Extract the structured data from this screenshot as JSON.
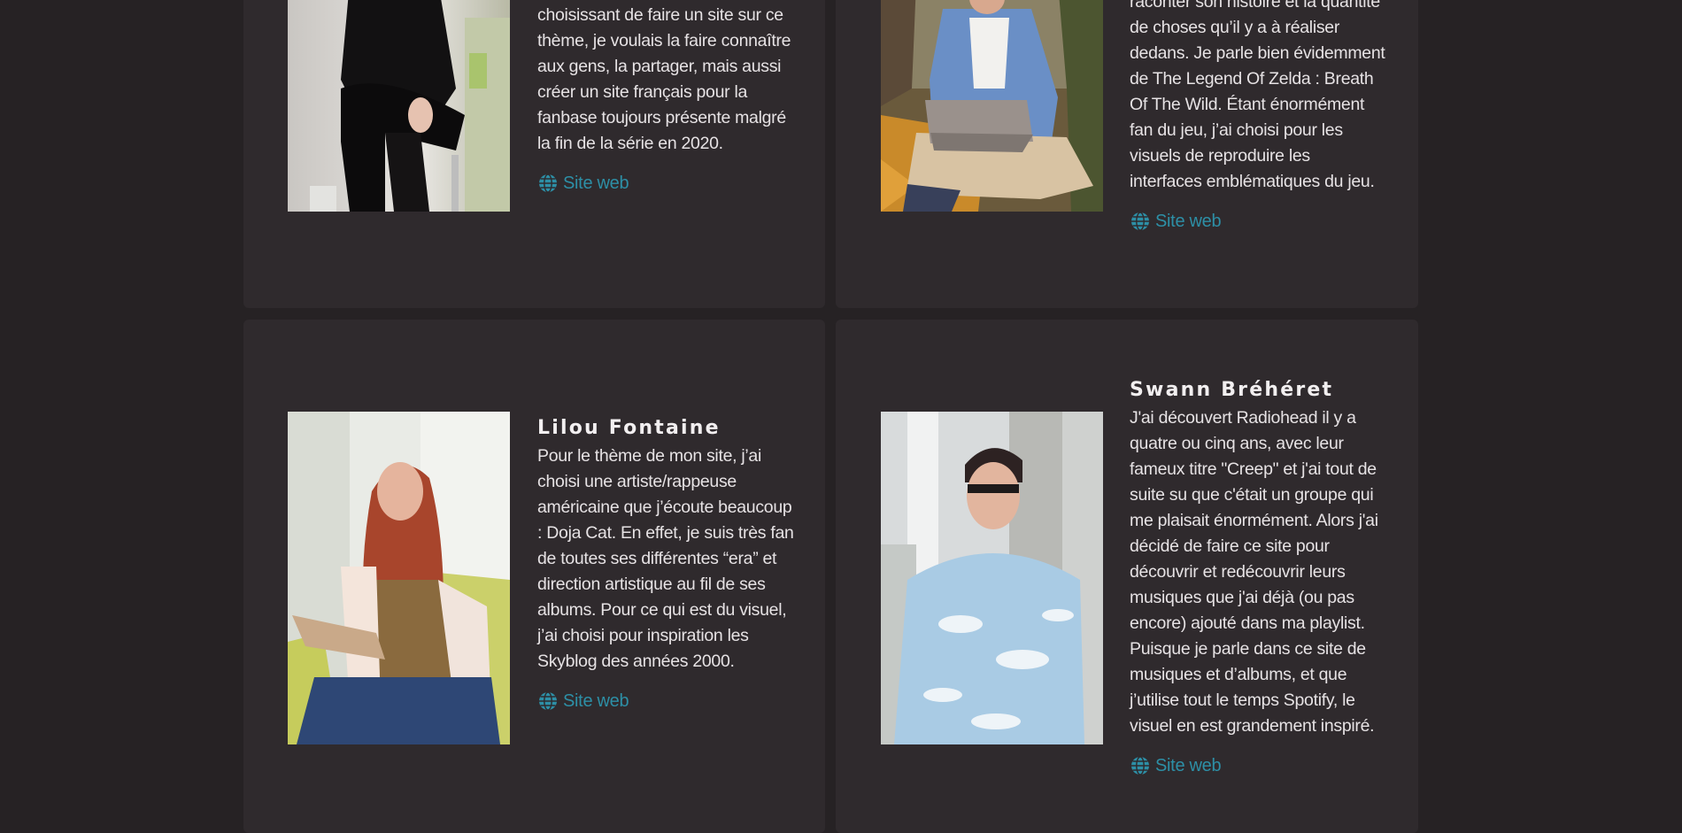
{
  "cards": [
    {
      "bio": "choisissant de faire un site sur ce thème, je voulais la faire connaître aux gens, la partager, mais aussi créer un site français pour la fanbase toujours présente malgré la fin de la série en 2020.",
      "link_label": "Site web",
      "link_icon": "globe-icon"
    },
    {
      "bio": "raconter son histoire et la quantité de choses qu’il y a à réaliser dedans. Je parle bien évidemment de The Legend Of Zelda : Breath Of The Wild. Étant énormément fan du jeu, j’ai choisi pour les visuels de reproduire les interfaces emblématiques du jeu.",
      "link_label": "Site web",
      "link_icon": "globe-icon"
    },
    {
      "name": "Lilou Fontaine",
      "bio": "Pour le thème de mon site, j’ai choisi une artiste/rappeuse américaine que j’écoute beaucoup : Doja Cat. En effet, je suis très fan de toutes ses différentes “era” et direction artistique au fil de ses albums. Pour ce qui est du visuel, j’ai choisi pour inspiration les Skyblog des années 2000.",
      "link_label": "Site web",
      "link_icon": "globe-icon"
    },
    {
      "name": "Swann Bréhéret",
      "bio": "J'ai découvert Radiohead il y a quatre ou cinq ans, avec leur fameux titre \"Creep\" et j'ai tout de suite su que c'était un groupe qui me plaisait énormément. Alors j'ai décidé de faire ce site pour découvrir et redécouvrir leurs musiques que j'ai déjà (ou pas encore) ajouté dans ma playlist. Puisque je parle dans ce site de musiques et d’albums, et que j’utilise tout le temps Spotify, le visuel en est grandement inspiré.",
      "link_label": "Site web",
      "link_icon": "globe-icon"
    }
  ],
  "colors": {
    "page_bg": "#262224",
    "card_bg": "#2f2a2d",
    "link": "#2d8fa6",
    "text": "#e6e2e4"
  }
}
